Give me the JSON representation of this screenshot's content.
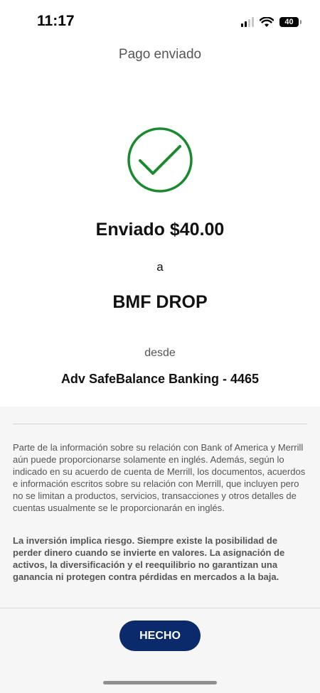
{
  "status_bar": {
    "time": "11:17",
    "battery_level": "40"
  },
  "nav": {
    "title": "Pago enviado"
  },
  "confirmation": {
    "amount_text": "Enviado $40.00",
    "to_label": "a",
    "recipient": "BMF DROP",
    "from_label": "desde",
    "account": "Adv SafeBalance Banking - 4465",
    "check_color": "#1a8a2e"
  },
  "disclosures": {
    "paragraph_1": "Parte de la información sobre su relación con Bank of America y Merrill aún puede proporcionarse solamente en inglés. Además, según lo indicado en su acuerdo de cuenta de Merrill, los documentos, acuerdos e información escritos sobre su relación con Merrill, que incluyen pero no se limitan a productos, servicios, transacciones y otros detalles de cuentas usualmente se le proporcionarán en inglés.",
    "paragraph_2": "La inversión implica riesgo. Siempre existe la posibilidad de perder dinero cuando se invierte en valores. La asignación de activos, la diversificación y el reequilibrio no garantizan una ganancia ni protegen contra pérdidas en mercados a la baja."
  },
  "actions": {
    "done_label": "HECHO",
    "button_color": "#0a2a6b"
  },
  "icons": {
    "check": "checkmark-circle-icon",
    "signal": "cellular-signal-icon",
    "wifi": "wifi-icon",
    "battery": "battery-icon"
  }
}
